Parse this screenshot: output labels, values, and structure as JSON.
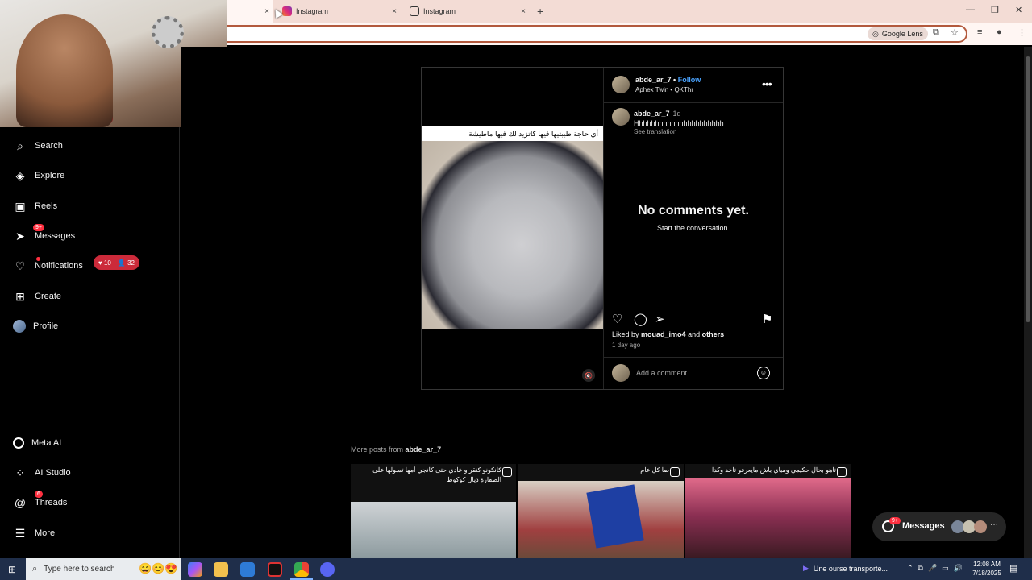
{
  "browser": {
    "tabs": [
      {
        "label": "",
        "close": "×"
      },
      {
        "label": "Instagram",
        "close": "×"
      },
      {
        "label": "Instagram",
        "close": "×"
      }
    ],
    "new_tab": "+",
    "window_controls": {
      "minimize": "—",
      "restore": "❐",
      "close": "✕"
    },
    "google_lens_label": "Google Lens",
    "omnibox_border_color": "#b35a3e"
  },
  "sidebar": {
    "items": [
      {
        "label": "Search",
        "icon": "search-icon"
      },
      {
        "label": "Explore",
        "icon": "compass-icon"
      },
      {
        "label": "Reels",
        "icon": "reels-icon"
      },
      {
        "label": "Messages",
        "icon": "messages-icon",
        "badge": "9+"
      },
      {
        "label": "Notifications",
        "icon": "heart-icon"
      },
      {
        "label": "Create",
        "icon": "plus-square-icon"
      },
      {
        "label": "Profile",
        "icon": "avatar-icon"
      },
      {
        "label": "Meta AI",
        "icon": "meta-ai-icon"
      },
      {
        "label": "AI Studio",
        "icon": "ai-studio-icon"
      },
      {
        "label": "Threads",
        "icon": "threads-icon",
        "badge": "6"
      },
      {
        "label": "More",
        "icon": "menu-icon"
      }
    ],
    "notifications_pill": {
      "likes": "10",
      "followers": "32"
    }
  },
  "post": {
    "media_caption": "أي حاجة طيبتيها فيها كاتزيد لك فيها ماطيشة",
    "header": {
      "username": "abde_ar_7",
      "separator": "•",
      "follow": "Follow",
      "audio": "Aphex Twin • QKThr"
    },
    "comment": {
      "username": "abde_ar_7",
      "time": "1d",
      "text": "Hhhhhhhhhhhhhhhhhhhhhh",
      "see_translation": "See translation"
    },
    "no_comments_title": "No comments yet.",
    "no_comments_sub": "Start the conversation.",
    "liked_by_prefix": "Liked by",
    "liked_by_user": "mouad_imo4",
    "liked_by_and": "and",
    "liked_by_others": "others",
    "posted_ago": "1 day ago",
    "add_comment_placeholder": "Add a comment..."
  },
  "more_posts": {
    "prefix": "More posts from",
    "username": "abde_ar_7",
    "thumbnails": [
      {
        "caption": "كانكونو كنقراو عادي حتى كانجي أمها تسولها على الصفارة ديال كوكوط"
      },
      {
        "caption": "صا كل عام"
      },
      {
        "caption": "تاهو بحال حكيمي ومباي باش مايعرفو تاخد وكدا"
      }
    ]
  },
  "messages_pill": {
    "label": "Messages",
    "badge": "9+",
    "more": "···"
  },
  "taskbar": {
    "search_placeholder": "Type here to search",
    "news": "Une ourse transporte...",
    "time": "12:08 AM",
    "date": "7/18/2025"
  }
}
